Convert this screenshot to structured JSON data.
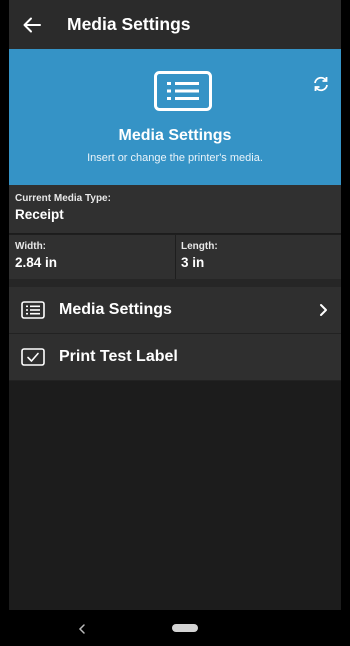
{
  "appbar": {
    "title": "Media Settings",
    "back_icon": "arrow-left-icon"
  },
  "hero": {
    "title": "Media Settings",
    "subtitle": "Insert or change the printer's media.",
    "icon": "list-box-icon",
    "refresh_icon": "refresh-icon",
    "background": "#3593c6"
  },
  "current_media": {
    "label": "Current Media Type:",
    "value": "Receipt"
  },
  "dimensions": {
    "width_label": "Width:",
    "width_value": "2.84 in",
    "length_label": "Length:",
    "length_value": "3 in"
  },
  "menu": [
    {
      "label": "Media Settings",
      "icon": "list-icon",
      "has_chevron": true
    },
    {
      "label": "Print Test Label",
      "icon": "checkbox-icon",
      "has_chevron": false
    }
  ],
  "navbar": {
    "back_icon": "nav-back-icon",
    "home_icon": "nav-home-pill"
  }
}
